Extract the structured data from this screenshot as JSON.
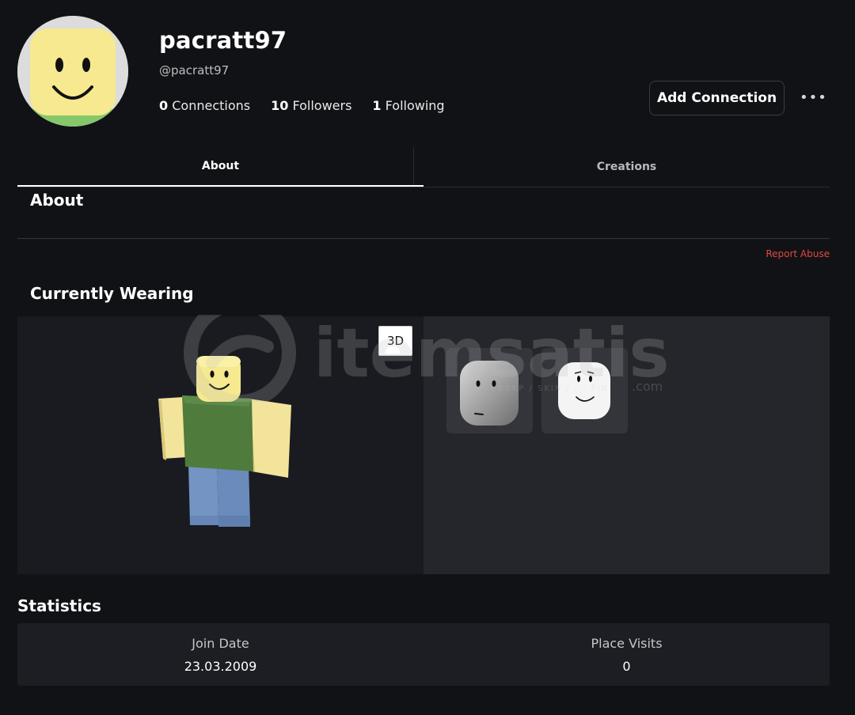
{
  "profile": {
    "display_name": "pacratt97",
    "username": "@pacratt97",
    "connections": {
      "count": "0",
      "label": "Connections"
    },
    "followers": {
      "count": "10",
      "label": "Followers"
    },
    "following": {
      "count": "1",
      "label": "Following"
    }
  },
  "actions": {
    "add_connection_label": "Add Connection",
    "more_icon": "ellipsis-icon",
    "more_glyph": "•••"
  },
  "tabs": [
    {
      "label": "About",
      "active": true
    },
    {
      "label": "Creations",
      "active": false
    }
  ],
  "about": {
    "heading": "About",
    "report_abuse": "Report Abuse"
  },
  "wearing": {
    "heading": "Currently Wearing",
    "view_toggle_label": "3D",
    "items": [
      {
        "icon": "gray-head-icon"
      },
      {
        "icon": "smile-face-icon"
      }
    ]
  },
  "watermark": {
    "brand": "itemsatis",
    "tagline": "HESAP / SKIN / ... PIN",
    "suffix": ".com"
  },
  "statistics": {
    "heading": "Statistics",
    "join_date_label": "Join Date",
    "join_date_value": "23.03.2009",
    "place_visits_label": "Place Visits",
    "place_visits_value": "0"
  },
  "colors": {
    "background": "#111216",
    "accent_report": "#e0493d",
    "avatar_skin": "#f5e58a",
    "shirt": "#4f7b3d",
    "pants": "#7494c4"
  }
}
